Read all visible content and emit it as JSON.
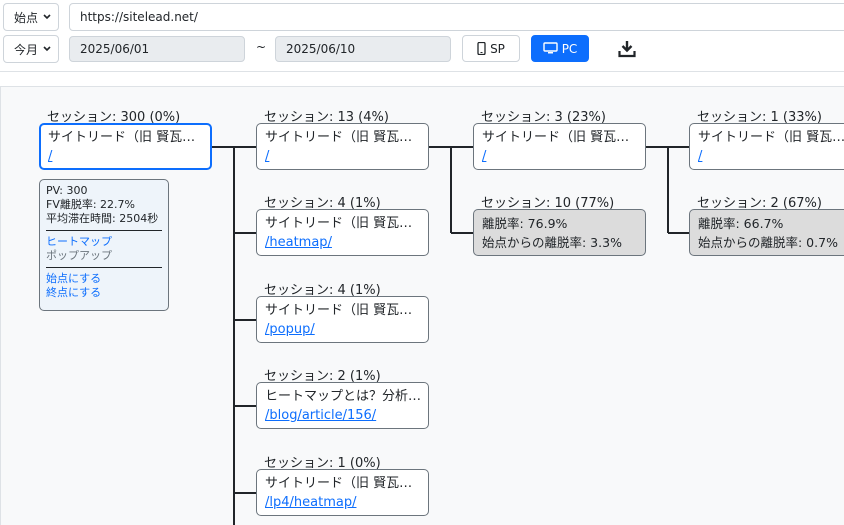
{
  "toolbar": {
    "mode_select": "始点",
    "url": "https://sitelead.net/",
    "period_select": "今月",
    "date_from": "2025/06/01",
    "date_sep": "~",
    "date_to": "2025/06/10",
    "sp_label": "SP",
    "pc_label": "PC",
    "accent": "#0d6efd"
  },
  "root": {
    "session": "セッション: 300 (0%)",
    "title": "サイトリード（旧 賢瓦…",
    "path": "/",
    "info": {
      "pv": "PV: 300",
      "fv": "FV離脱率: 22.7%",
      "avg": "平均滞在時間: 2504秒",
      "heatmap": "ヒートマップ",
      "popup": "ポップアップ",
      "set_start": "始点にする",
      "set_end": "終点にする"
    }
  },
  "col2": [
    {
      "session": "セッション: 13 (4%)",
      "title": "サイトリード（旧 賢瓦…",
      "path": "/"
    },
    {
      "session": "セッション: 4 (1%)",
      "title": "サイトリード（旧 賢瓦…",
      "path": "/heatmap/"
    },
    {
      "session": "セッション: 4 (1%)",
      "title": "サイトリード（旧 賢瓦…",
      "path": "/popup/"
    },
    {
      "session": "セッション: 2 (1%)",
      "title": "ヒートマップとは？分析…",
      "path": "/blog/article/156/"
    },
    {
      "session": "セッション: 1 (0%)",
      "title": "サイトリード（旧 賢瓦…",
      "path": "/lp4/heatmap/"
    }
  ],
  "col3": {
    "node": {
      "session": "セッション: 3 (23%)",
      "title": "サイトリード（旧 賢瓦…",
      "path": "/"
    },
    "exit": {
      "session": "セッション: 10 (77%)",
      "rate": "離脱率: 76.9%",
      "from_start": "始点からの離脱率: 3.3%"
    }
  },
  "col4": {
    "node": {
      "session": "セッション: 1 (33%)",
      "title": "サイトリード（旧 賢瓦…",
      "path": "/"
    },
    "exit": {
      "session": "セッション: 2 (67%)",
      "rate": "離脱率: 66.7%",
      "from_start": "始点からの離脱率: 0.7%"
    }
  }
}
